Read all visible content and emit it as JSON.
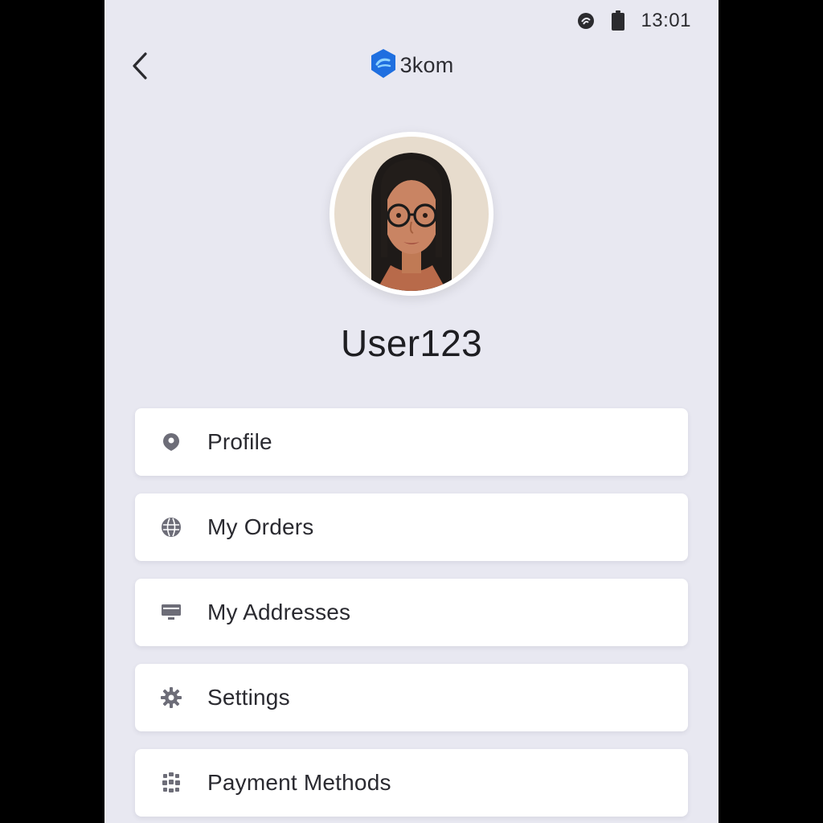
{
  "status_bar": {
    "time": "13:01",
    "icons": [
      "signal-icon",
      "battery-icon"
    ]
  },
  "header": {
    "back_icon": "chevron-left-icon",
    "brand_name": "3kom",
    "brand_color": "#1f6fe0"
  },
  "profile": {
    "username": "User123"
  },
  "menu": {
    "items": [
      {
        "label": "Profile",
        "icon": "location-pin-icon"
      },
      {
        "label": "My Orders",
        "icon": "globe-icon"
      },
      {
        "label": "My Addresses",
        "icon": "monitor-icon"
      },
      {
        "label": "Settings",
        "icon": "gear-icon"
      },
      {
        "label": "Payment Methods",
        "icon": "grid-cube-icon"
      }
    ]
  },
  "colors": {
    "background": "#e8e8f1",
    "card": "#ffffff",
    "icon_gray": "#6d6d78"
  }
}
